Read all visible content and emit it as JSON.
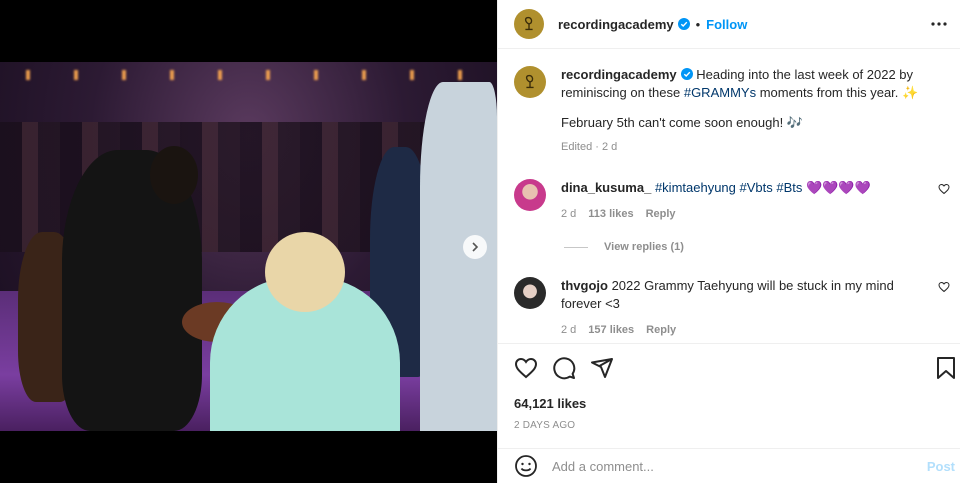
{
  "post": {
    "username": "recordingacademy",
    "follow_label": "Follow",
    "separator": "•"
  },
  "caption": {
    "username": "recordingacademy",
    "text_before": " Heading into the last week of 2022 by reminiscing on these ",
    "hashtag": "#GRAMMYs",
    "text_after": " moments from this year. ✨",
    "line2": "February 5th can't come soon enough! 🎶",
    "edited": "Edited · 2 d"
  },
  "comments": [
    {
      "username": "dina_kusuma_",
      "tags": "#kimtaehyung #Vbts #Bts",
      "emoji": "💜💜💜💜",
      "time": "2 d",
      "likes": "113 likes",
      "reply_label": "Reply"
    },
    {
      "username": "thvgojo",
      "text": "2022 Grammy Taehyung will be stuck in my mind forever <3",
      "time": "2 d",
      "likes": "157 likes",
      "reply_label": "Reply"
    }
  ],
  "view_replies": "View replies (1)",
  "likes_count": "64,121 likes",
  "posted_ago": "2 DAYS AGO",
  "add_comment": {
    "placeholder": "Add a comment...",
    "post_label": "Post"
  },
  "colors": {
    "accent": "#0095f6",
    "link": "#00376b",
    "muted": "#8e8e8e",
    "heart_purple": "#8a4fd8",
    "post_disabled": "#b2dffc",
    "avatar_gold": "#b0902e"
  },
  "icons": [
    "verified-badge-icon",
    "more-options-icon",
    "chevron-right-icon",
    "heart-icon",
    "comment-icon",
    "share-icon",
    "bookmark-icon",
    "emoji-icon"
  ]
}
